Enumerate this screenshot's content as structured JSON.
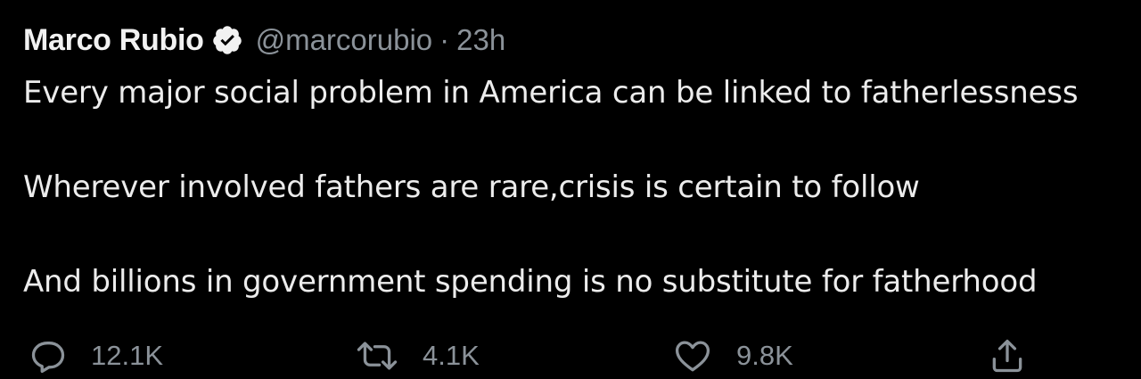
{
  "tweet": {
    "author_name": "Marco Rubio",
    "verified": true,
    "handle": "@marcorubio",
    "separator": "·",
    "time": "23h",
    "lines": [
      "Every major social problem in America can be linked to fatherlessness",
      "Wherever involved fathers are rare,crisis is certain to follow",
      "And billions in government spending is no substitute for fatherhood"
    ]
  },
  "actions": {
    "reply_count": "12.1K",
    "retweet_count": "4.1K",
    "like_count": "9.8K"
  },
  "icons": {
    "reply": "reply-icon",
    "retweet": "retweet-icon",
    "like": "heart-icon",
    "share": "share-icon",
    "verified": "verified-badge-icon"
  },
  "colors": {
    "background": "#000000",
    "text": "#ececec",
    "muted": "#8b9299",
    "badge": "#f2f2f2"
  }
}
